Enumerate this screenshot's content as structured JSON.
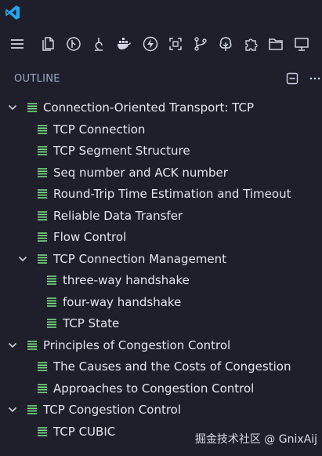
{
  "panel": {
    "title": "OUTLINE"
  },
  "toolbar_icons": [
    "menu-icon",
    "files-icon",
    "git-graph-icon",
    "source-branch-icon",
    "docker-icon",
    "lightning-icon",
    "scan-icon",
    "source-control-icon",
    "tree-icon",
    "extensions-icon",
    "folder-icon",
    "monitor-icon"
  ],
  "header_actions": [
    "collapse-all-icon",
    "more-actions-icon"
  ],
  "tree": [
    {
      "label": "Connection-Oriented Transport: TCP",
      "level": 0,
      "expanded": true
    },
    {
      "label": "TCP Connection",
      "level": 1
    },
    {
      "label": "TCP Segment Structure",
      "level": 1
    },
    {
      "label": "Seq number and ACK number",
      "level": 1
    },
    {
      "label": "Round-Trip Time Estimation and Timeout",
      "level": 1
    },
    {
      "label": "Reliable Data Transfer",
      "level": 1
    },
    {
      "label": "Flow Control",
      "level": 1
    },
    {
      "label": "TCP Connection Management",
      "level": 1,
      "expanded": true
    },
    {
      "label": "three-way handshake",
      "level": 2
    },
    {
      "label": "four-way handshake",
      "level": 2
    },
    {
      "label": "TCP State",
      "level": 2
    },
    {
      "label": "Principles of Congestion Control",
      "level": 0,
      "expanded": true
    },
    {
      "label": "The Causes and the Costs of Congestion",
      "level": 1
    },
    {
      "label": "Approaches to Congestion Control",
      "level": 1
    },
    {
      "label": "TCP Congestion Control",
      "level": 0,
      "expanded": true
    },
    {
      "label": "TCP CUBIC",
      "level": 1
    }
  ],
  "colors": {
    "background": "#1e1f2b",
    "icon_green": "#7ee787",
    "text": "#e4e6ee",
    "vscode_blue": "#22a7f2"
  },
  "watermark": "掘金技术社区 @ GnixAij"
}
